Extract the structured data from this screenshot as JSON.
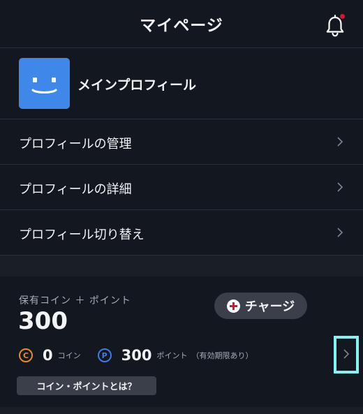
{
  "header": {
    "title": "マイページ",
    "has_notification": true
  },
  "profile": {
    "name": "メインプロフィール",
    "avatar_color": "#3f87e8"
  },
  "menu": [
    {
      "label": "プロフィールの管理"
    },
    {
      "label": "プロフィールの詳細"
    },
    {
      "label": "プロフィール切り替え"
    }
  ],
  "coins": {
    "title": "保有コイン ＋ ポイント",
    "total": "300",
    "charge_label": "チャージ",
    "coin_badge": "C",
    "coin_amount": "0",
    "coin_unit": "コイン",
    "point_badge": "P",
    "point_amount": "300",
    "point_unit": "ポイント",
    "point_note": "（有効期限あり）",
    "help_label": "コイン・ポイントとは？"
  },
  "colors": {
    "background": "#131720",
    "accent_red": "#e01133",
    "coin_orange": "#e58d1f",
    "point_blue": "#3f7be0",
    "highlight": "#86f3f3"
  }
}
